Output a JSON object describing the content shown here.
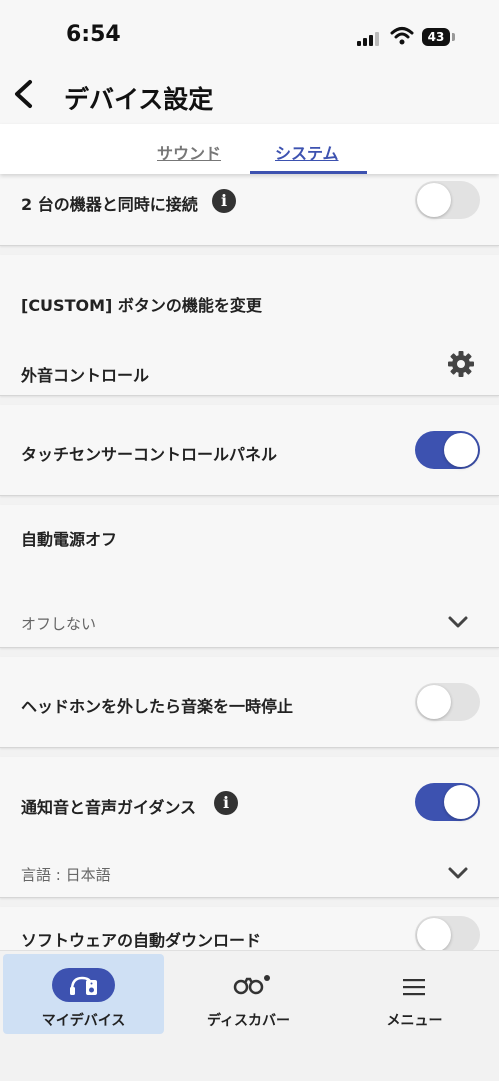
{
  "status_bar": {
    "time": "6:54",
    "battery": "43"
  },
  "header": {
    "title": "デバイス設定"
  },
  "tabs": [
    {
      "label": "サウンド"
    },
    {
      "label": "システム"
    }
  ],
  "settings": {
    "multipoint": {
      "label": "2 台の機器と同時に接続",
      "enabled": false
    },
    "custom_button": {
      "label": "[CUSTOM] ボタンの機能を変更",
      "value": "外音コントロール"
    },
    "touch_panel": {
      "label": "タッチセンサーコントロールパネル",
      "enabled": true
    },
    "auto_power_off": {
      "label": "自動電源オフ",
      "value": "オフしない"
    },
    "pause_on_removal": {
      "label": "ヘッドホンを外したら音楽を一時停止",
      "enabled": false
    },
    "notification_voice": {
      "label": "通知音と音声ガイダンス",
      "enabled": true,
      "language": "言語 : 日本語"
    },
    "software_download": {
      "label": "ソフトウェアの自動ダウンロード",
      "enabled": false
    }
  },
  "bottom_nav": [
    {
      "label": "マイデバイス"
    },
    {
      "label": "ディスカバー"
    },
    {
      "label": "メニュー"
    }
  ],
  "colors": {
    "accent": "#3d52b0",
    "toggle_off": "#e2e2e2",
    "active_nav": "#cfe0f4"
  }
}
